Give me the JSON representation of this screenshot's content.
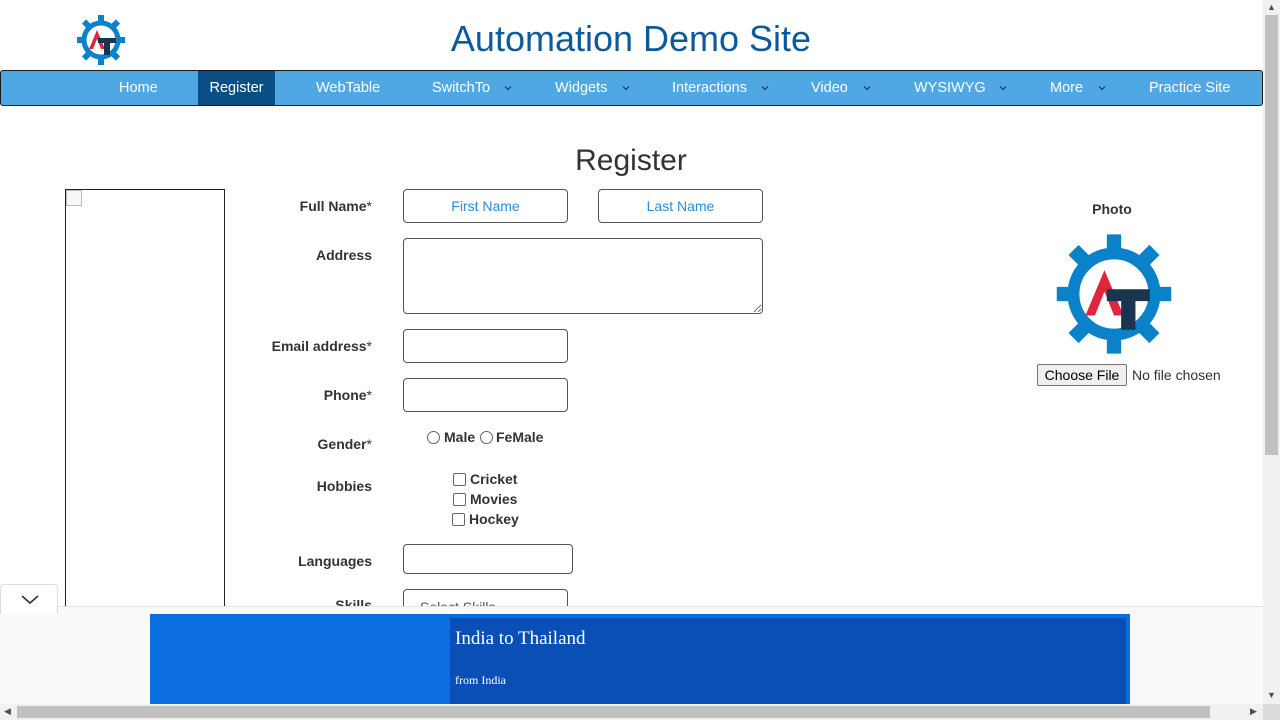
{
  "header": {
    "title": "Automation Demo Site",
    "logo_icon": "automation-testing-gear-logo",
    "brand_colors": {
      "blue": "#0a82c9",
      "red": "#e0263f",
      "navy": "#1a3550"
    }
  },
  "nav": {
    "items": [
      {
        "label": "Home",
        "has_dropdown": false
      },
      {
        "label": "Register",
        "has_dropdown": false,
        "active": true
      },
      {
        "label": "WebTable",
        "has_dropdown": false
      },
      {
        "label": "SwitchTo",
        "has_dropdown": true
      },
      {
        "label": "Widgets",
        "has_dropdown": true
      },
      {
        "label": "Interactions",
        "has_dropdown": true
      },
      {
        "label": "Video",
        "has_dropdown": true
      },
      {
        "label": "WYSIWYG",
        "has_dropdown": true
      },
      {
        "label": "More",
        "has_dropdown": true
      },
      {
        "label": "Practice Site",
        "has_dropdown": false
      }
    ],
    "bg_color": "#4fa8e4",
    "active_color": "#0a4f83"
  },
  "form": {
    "heading": "Register",
    "full_name": {
      "label": "Full Name",
      "required_mark": "*",
      "first_placeholder": "First Name",
      "last_placeholder": "Last Name",
      "first_value": "",
      "last_value": ""
    },
    "address": {
      "label": "Address",
      "value": ""
    },
    "email": {
      "label": "Email address",
      "required_mark": "*",
      "value": ""
    },
    "phone": {
      "label": "Phone",
      "required_mark": "*",
      "value": ""
    },
    "gender": {
      "label": "Gender",
      "required_mark": "*",
      "options": [
        "Male",
        "FeMale"
      ],
      "selected": null
    },
    "hobbies": {
      "label": "Hobbies",
      "options": [
        "Cricket",
        "Movies",
        "Hockey"
      ],
      "checked": []
    },
    "languages": {
      "label": "Languages",
      "value": ""
    },
    "skills": {
      "label": "Skills",
      "selected": "Select Skills"
    }
  },
  "photo": {
    "label": "Photo",
    "button_label": "Choose File",
    "status_text": "No file chosen"
  },
  "ad": {
    "title": "India to Thailand",
    "subtitle": "from India",
    "collapse_icon": "chevron-down-icon"
  }
}
